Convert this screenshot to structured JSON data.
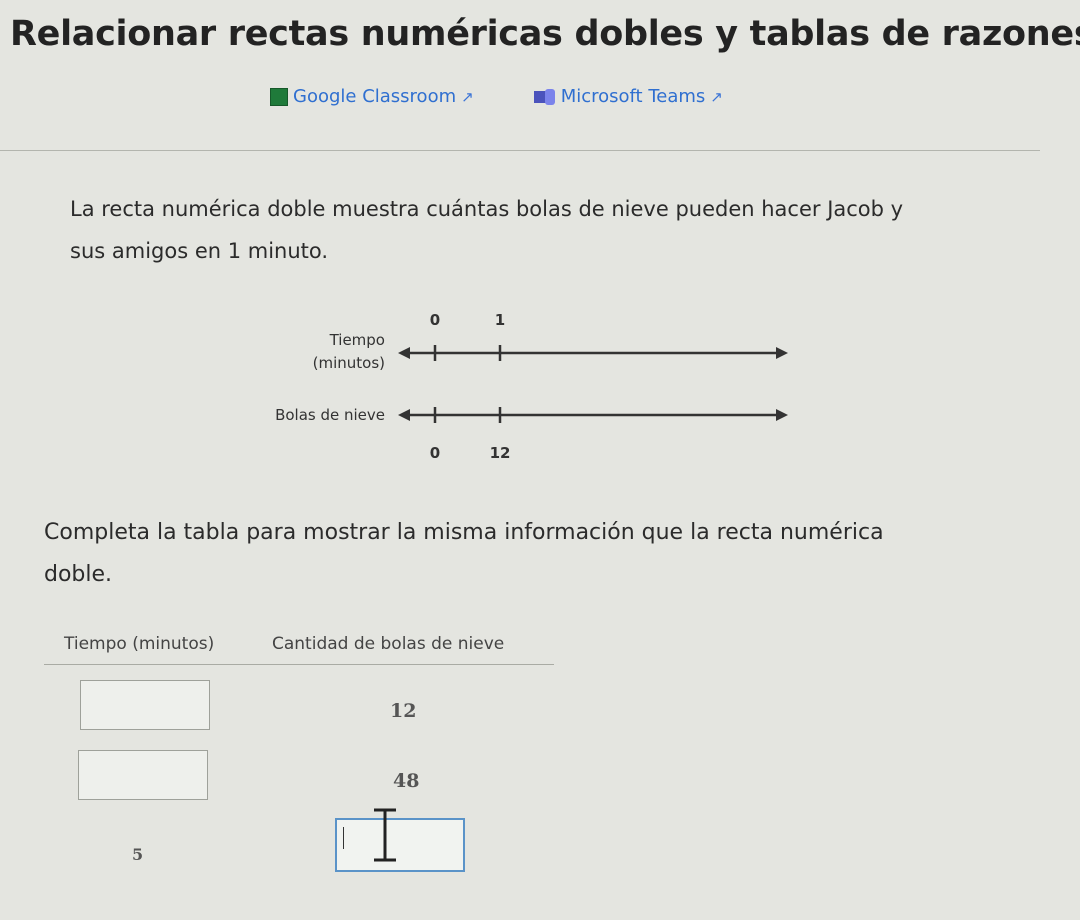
{
  "page": {
    "title": "Relacionar rectas numéricas dobles y tablas de razones"
  },
  "share": {
    "google_classroom": "Google Classroom",
    "microsoft_teams": "Microsoft Teams"
  },
  "problem": {
    "prompt": "La recta numérica doble muestra cuántas bolas de nieve pueden hacer Jacob y sus amigos en 1 minuto.",
    "instruction": "Completa la tabla para mostrar la misma información que la recta numérica doble."
  },
  "diagram": {
    "top_line_label_1": "Tiempo",
    "top_line_label_2": "(minutos)",
    "bottom_line_label": "Bolas de nieve",
    "top_tick_labels": [
      "0",
      "1"
    ],
    "bottom_tick_labels": [
      "0",
      "12"
    ]
  },
  "table": {
    "headers": [
      "Tiempo (minutos)",
      "Cantidad de bolas de nieve"
    ],
    "rows": [
      {
        "tiempo": "",
        "bolas": "12"
      },
      {
        "tiempo": "",
        "bolas": "48"
      },
      {
        "tiempo": "5",
        "bolas": ""
      }
    ]
  },
  "colors": {
    "link": "#2f6fd0",
    "active_input_border": "#5a93c8"
  }
}
